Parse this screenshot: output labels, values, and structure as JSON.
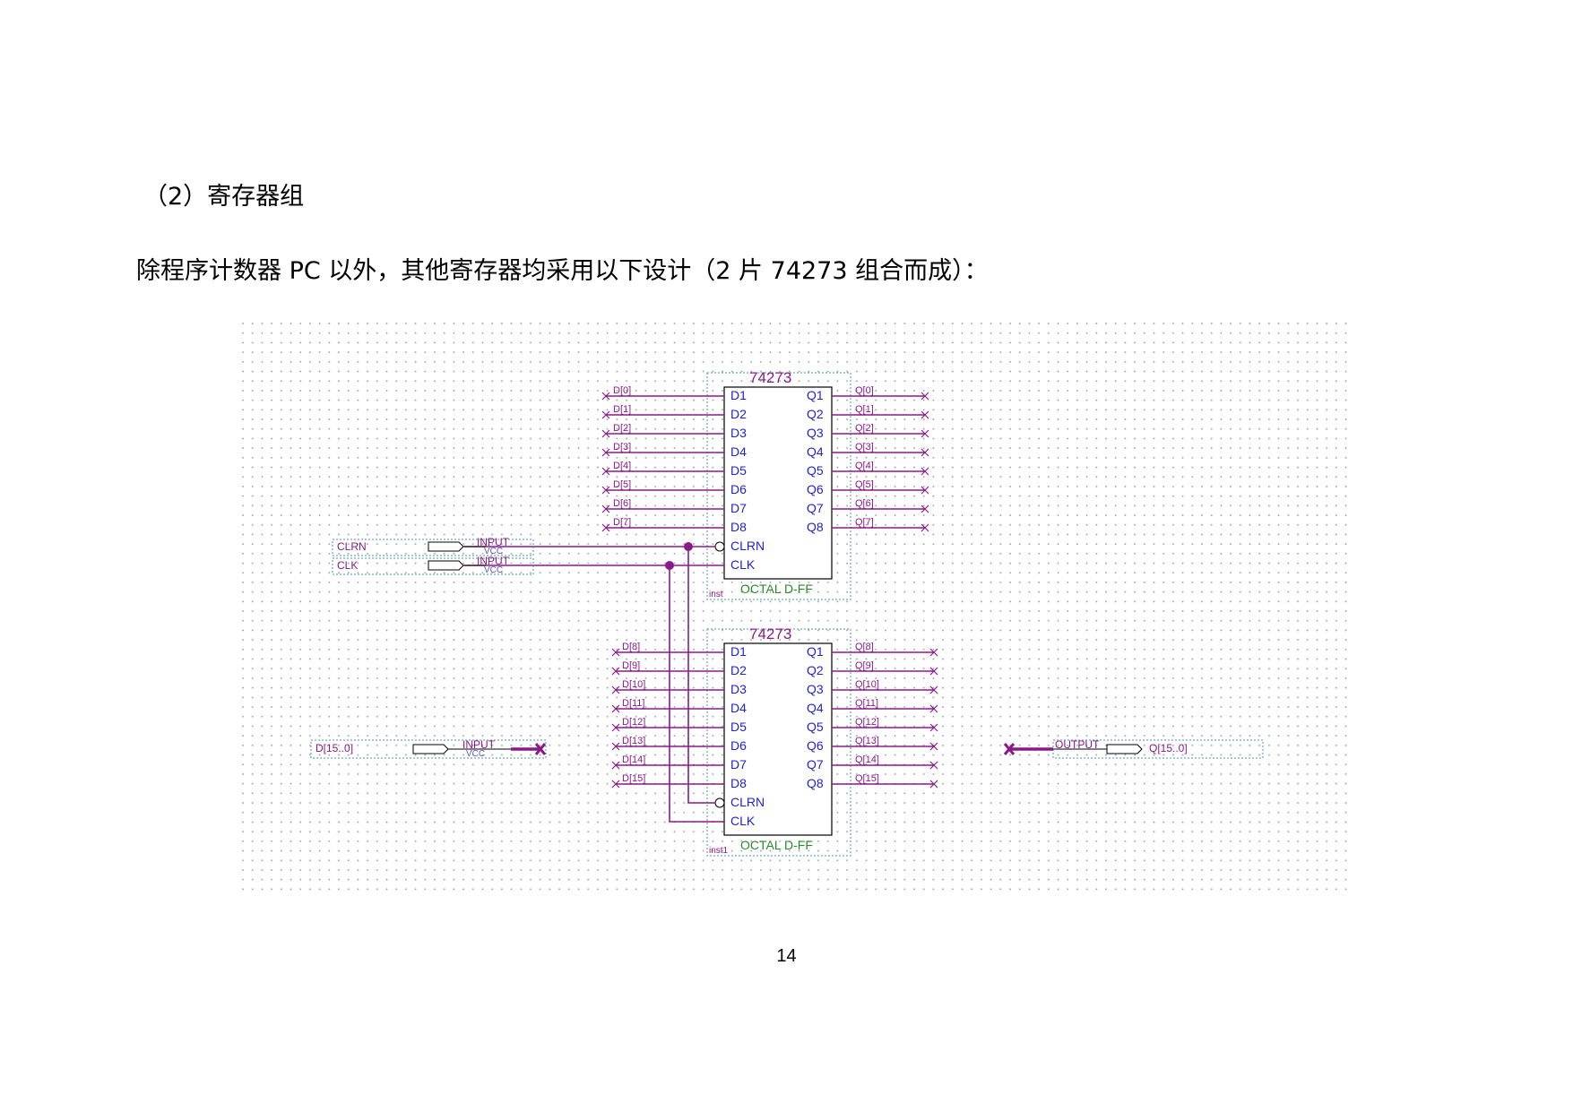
{
  "heading": "（2）寄存器组",
  "paragraph": "除程序计数器 PC 以外，其他寄存器均采用以下设计（2 片 74273 组合而成）：",
  "page_number": "14",
  "schematic": {
    "colors": {
      "wire": "#8a1a8a",
      "pin_text": "#2222cc",
      "part_desc": "#2a8a2a",
      "grid_dot": "#9a9a9a",
      "frame": "#4a9a9a"
    },
    "chips": [
      {
        "part": "74273",
        "desc": "OCTAL D-FF",
        "inst": "inst",
        "d_pins": [
          "D1",
          "D2",
          "D3",
          "D4",
          "D5",
          "D6",
          "D7",
          "D8"
        ],
        "q_pins": [
          "Q1",
          "Q2",
          "Q3",
          "Q4",
          "Q5",
          "Q6",
          "Q7",
          "Q8"
        ],
        "ctrl_pins": [
          "CLRN",
          "CLK"
        ],
        "d_nets": [
          "D[0]",
          "D[1]",
          "D[2]",
          "D[3]",
          "D[4]",
          "D[5]",
          "D[6]",
          "D[7]"
        ],
        "q_nets": [
          "Q[0]",
          "Q[1]",
          "Q[2]",
          "Q[3]",
          "Q[4]",
          "Q[5]",
          "Q[6]",
          "Q[7]"
        ]
      },
      {
        "part": "74273",
        "desc": "OCTAL D-FF",
        "inst": "inst1",
        "d_pins": [
          "D1",
          "D2",
          "D3",
          "D4",
          "D5",
          "D6",
          "D7",
          "D8"
        ],
        "q_pins": [
          "Q1",
          "Q2",
          "Q3",
          "Q4",
          "Q5",
          "Q6",
          "Q7",
          "Q8"
        ],
        "ctrl_pins": [
          "CLRN",
          "CLK"
        ],
        "d_nets": [
          "D[8]",
          "D[9]",
          "D[10]",
          "D[11]",
          "D[12]",
          "D[13]",
          "D[14]",
          "D[15]"
        ],
        "q_nets": [
          "Q[8]",
          "Q[9]",
          "Q[10]",
          "Q[11]",
          "Q[12]",
          "Q[13]",
          "Q[14]",
          "Q[15]"
        ]
      }
    ],
    "ports": [
      {
        "name": "CLRN",
        "kind": "INPUT",
        "default": "VCC"
      },
      {
        "name": "CLK",
        "kind": "INPUT",
        "default": "VCC"
      },
      {
        "name": "D[15..0]",
        "kind": "INPUT",
        "default": "VCC"
      },
      {
        "name": "Q[15..0]",
        "kind": "OUTPUT"
      }
    ]
  }
}
